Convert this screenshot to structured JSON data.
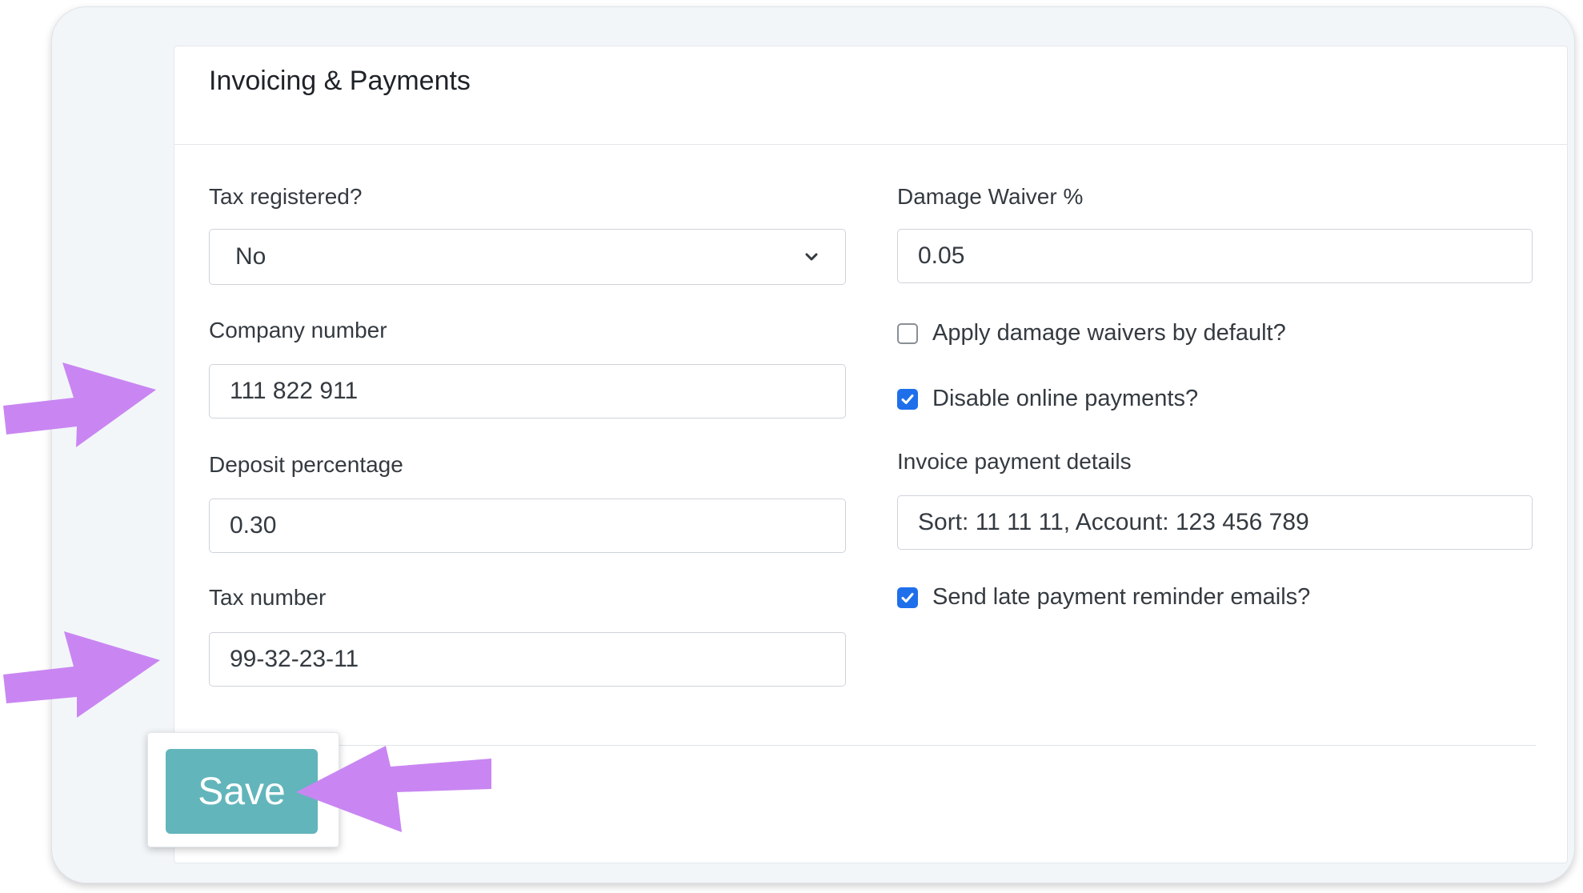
{
  "card": {
    "title": "Invoicing & Payments"
  },
  "left": {
    "tax_registered": {
      "label": "Tax registered?",
      "value": "No"
    },
    "company_number": {
      "label": "Company number",
      "value": "111 822 911"
    },
    "deposit_percentage": {
      "label": "Deposit percentage",
      "value": "0.30"
    },
    "tax_number": {
      "label": "Tax number",
      "value": "99-32-23-11"
    }
  },
  "right": {
    "damage_waiver": {
      "label": "Damage Waiver %",
      "value": "0.05"
    },
    "apply_damage_waivers": {
      "label": "Apply damage waivers by default?",
      "checked": false
    },
    "disable_online_payments": {
      "label": "Disable online payments?",
      "checked": true
    },
    "invoice_payment_details": {
      "label": "Invoice payment details",
      "value": "Sort: 11 11 11, Account: 123 456 789"
    },
    "late_payment_reminders": {
      "label": "Send late payment reminder emails?",
      "checked": true
    }
  },
  "actions": {
    "save_label": "Save"
  },
  "colors": {
    "accent_button": "#62b5bb",
    "checkbox_checked": "#1f6feb",
    "annotation_arrow": "#c986f2"
  },
  "icons": {
    "select_chevron": "chevron-down-icon",
    "checkmark": "checkmark-icon",
    "annotation": "arrow-icon"
  }
}
